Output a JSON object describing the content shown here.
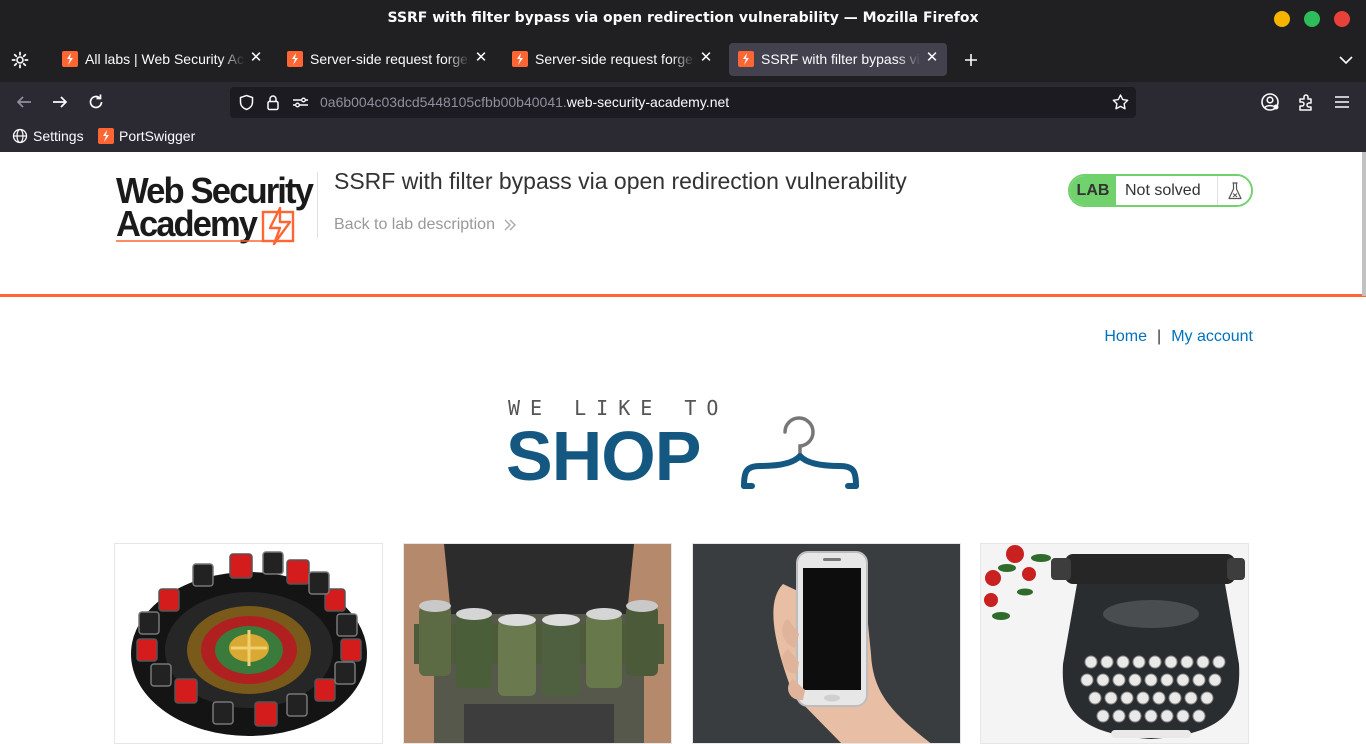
{
  "window": {
    "title": "SSRF with filter bypass via open redirection vulnerability — Mozilla Firefox"
  },
  "tabs": [
    {
      "label": "All labs | Web Security Academy",
      "active": false
    },
    {
      "label": "Server-side request forgery (SSRF)",
      "active": false
    },
    {
      "label": "Server-side request forgery (SSRF)",
      "active": false
    },
    {
      "label": "SSRF with filter bypass via open redirection vulnerability",
      "active": true
    }
  ],
  "urlbar": {
    "url_host_prefix": "0a6b004c03dcd5448105cfbb00b40041.",
    "url_domain": "web-security-academy.net"
  },
  "bookmarks": [
    {
      "label": "Settings",
      "icon": "globe-icon"
    },
    {
      "label": "PortSwigger",
      "icon": "portswigger-icon"
    }
  ],
  "lab_header": {
    "logo_line1": "Web Security",
    "logo_line2": "Academy",
    "title": "SSRF with filter bypass via open redirection vulnerability",
    "back_link": "Back to lab description",
    "badge": "LAB",
    "status": "Not solved"
  },
  "nav": {
    "home": "Home",
    "separator": "|",
    "account": "My account"
  },
  "banner": {
    "small": "WE LIKE TO",
    "big": "SHOP"
  },
  "products": [
    {
      "image": "roulette-drinking-game"
    },
    {
      "image": "beer-belt"
    },
    {
      "image": "smartphone-in-hand"
    },
    {
      "image": "typewriter-with-roses"
    }
  ],
  "colors": {
    "accent": "#ff6633",
    "lab_green": "#70d16d",
    "link": "#0071bc",
    "shop_blue": "#145882"
  }
}
